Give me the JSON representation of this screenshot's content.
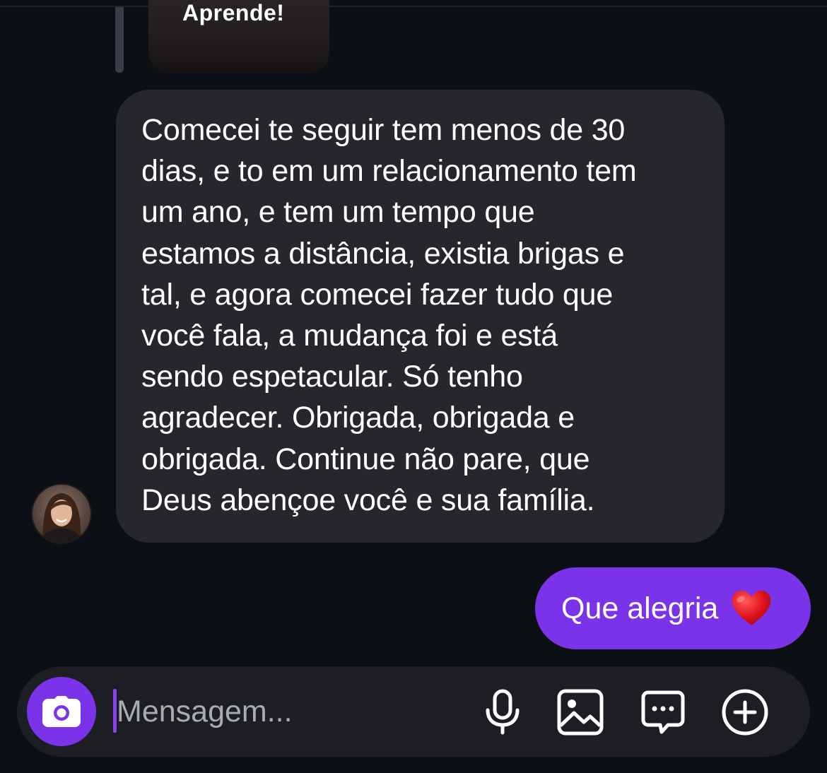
{
  "shared_post": {
    "title": "Aprende!"
  },
  "incoming_message": {
    "text": "Comecei te seguir tem menos de 30\ndias, e to em um relacionamento tem\num ano, e tem um tempo que\nestamos a distância, existia brigas e\ntal, e agora comecei fazer tudo que\nvocê fala, a mudança foi e está\nsendo espetacular. Só tenho\nagradecer. Obrigada, obrigada e\nobrigada. Continue não pare, que\nDeus abençoe você e sua família."
  },
  "outgoing_message": {
    "text": "Que alegria",
    "emoji_icon": "red-heart-icon"
  },
  "composer": {
    "placeholder": "Mensagem...",
    "value": "",
    "tools": [
      "camera-icon",
      "microphone-icon",
      "gallery-icon",
      "sticker-icon",
      "add-icon"
    ]
  },
  "colors": {
    "background": "#0c0f14",
    "incoming_bubble": "#25272c",
    "outgoing_bubble": "#7b33ea",
    "composer": "#1c1e23",
    "accent": "#7b33ea"
  }
}
